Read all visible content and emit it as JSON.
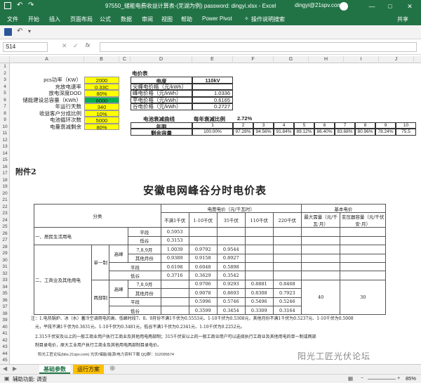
{
  "window": {
    "title": "97550_储能电费收益计算表-(芜湖为例) password: dingyi.xlsx  -  Excel",
    "user": "dingyi@21spv.com",
    "controls": [
      "—",
      "□",
      "✕"
    ]
  },
  "ribbon": {
    "tabs": [
      "文件",
      "开始",
      "插入",
      "页面布局",
      "公式",
      "数据",
      "审阅",
      "视图",
      "帮助",
      "Power Pivot"
    ],
    "search": "操作说明搜索",
    "share": "共享"
  },
  "formula_bar": {
    "name_box": "S14",
    "formula": "",
    "fx": "fx"
  },
  "columns": [
    "A",
    "B",
    "C",
    "D",
    "E",
    "F",
    "G",
    "H",
    "I",
    "J"
  ],
  "rows": [
    "1",
    "2",
    "3",
    "4",
    "5",
    "6",
    "7",
    "8",
    "9",
    "10",
    "11",
    "12",
    "13",
    "14",
    "15",
    "16",
    "17",
    "18",
    "19",
    "20",
    "21",
    "22",
    "23",
    "24",
    "25",
    "26",
    "27",
    "28",
    "29",
    "30",
    "31",
    "32",
    "33",
    "34",
    "35",
    "36",
    "37",
    "38",
    "39",
    "40",
    "41",
    "42",
    "43",
    "44",
    "45"
  ],
  "params": [
    {
      "label": "pcs功率（KW）",
      "value": "2000"
    },
    {
      "label": "充放电速率",
      "value": "0.33C"
    },
    {
      "label": "放电深度DOD",
      "value": "80%"
    },
    {
      "label": "储能建设总容量（KWh）",
      "value": "6000"
    },
    {
      "label": "年运行天数",
      "value": "340"
    },
    {
      "label": "收益客户分成比例",
      "value": "10%"
    },
    {
      "label": "电池循环次数",
      "value": "5000"
    },
    {
      "label": "电量衰减剩余",
      "value": "80%"
    }
  ],
  "price_table": {
    "header": "电价表",
    "col1": "电度",
    "col2": "110kV",
    "rows": [
      {
        "label": "尖峰电价格（元/kWh）",
        "value": ""
      },
      {
        "label": "峰电价格（元/kWh）",
        "value": "1.0336"
      },
      {
        "label": "平电价格（元/kWh）",
        "value": "0.6165"
      },
      {
        "label": "谷电价格（元/kWh）",
        "value": "0.2727"
      }
    ]
  },
  "decay": {
    "title": "电池衰减曲线",
    "rate_label": "每年衰减比例",
    "rate": "2.72%",
    "year_label": "年限",
    "years": [
      "1",
      "2",
      "3",
      "4",
      "5",
      "6",
      "7",
      "8",
      "9",
      "10"
    ],
    "cap_label": "剩余容量",
    "capacities": [
      "100.00%",
      "97.28%",
      "94.56%",
      "91.84%",
      "89.12%",
      "86.40%",
      "83.68%",
      "80.96%",
      "78.24%",
      "75.5"
    ]
  },
  "picture": {
    "attachment": "附件2",
    "title": "安徽电网峰谷分时电价表",
    "hdr_category": "分类",
    "hdr_energy": "电度电价（元/千瓦时）",
    "hdr_basic": "基本电价",
    "voltage_cols": [
      "不满1千伏",
      "1-10千伏",
      "35千伏",
      "110千伏",
      "220千伏"
    ],
    "basic_cols": [
      "最大需量（元/千瓦·月）",
      "变压器容量（元/千伏安·月）"
    ],
    "residential": "一、居民生活用电",
    "res_rows": [
      {
        "period": "平段",
        "v": "0.5953"
      },
      {
        "period": "低谷",
        "v": "0.3153"
      }
    ],
    "commercial": "二、工商业及其他用电",
    "single": "单一制",
    "dual": "两部制",
    "peak": "高峰",
    "single_rows": [
      {
        "period": "7,8,9月",
        "vals": [
          "1.0039",
          "0.9792",
          "0.9544",
          "",
          ""
        ]
      },
      {
        "period": "其他月份",
        "vals": [
          "0.9389",
          "0.9158",
          "0.8927",
          "",
          ""
        ]
      },
      {
        "period": "平段",
        "vals": [
          "0.6198",
          "0.6048",
          "0.5898",
          "",
          ""
        ]
      },
      {
        "period": "低谷",
        "vals": [
          "0.3716",
          "0.3629",
          "0.3542",
          "",
          ""
        ]
      }
    ],
    "dual_rows": [
      {
        "period": "7,8,9月",
        "vals": [
          "",
          "0.9706",
          "0.9293",
          "0.8881",
          "0.8468"
        ]
      },
      {
        "period": "其他月份",
        "vals": [
          "",
          "0.9078",
          "0.8693",
          "0.8308",
          "0.7923"
        ]
      },
      {
        "period": "平段",
        "vals": [
          "",
          "0.5996",
          "0.5746",
          "0.5496",
          "0.5246"
        ]
      },
      {
        "period": "低谷",
        "vals": [
          "",
          "0.3599",
          "0.3454",
          "0.3309",
          "0.3164"
        ]
      }
    ],
    "basic_values": [
      "40",
      "30"
    ],
    "notes": [
      "注：1.电热锅炉、冰（水）蓄冷空调用电的高、低峰时段7、8、9月份不满1千伏为0.5553元、1-10千伏为0.5308元，其他月份不满1千伏为0.5237元、1-10千伏为0.5008",
      "元，平段不满1千伏为0.3631元、1-10千伏为0.3481元，低谷不满1千伏为0.2341元、1-10千伏为0.2252元。",
      "2.315千伏安及以上的一般工商业用户执行工商业及其他用电两部制；315千伏安以上的一般工商业用户可以选择执行工商业及其他用电的单一制或两部",
      "制目录电价，原大工业用户执行工商业及其他用电两部制目录电价。"
    ],
    "footer": "阳光工匠论坛(bbs.21spv.com)    光伏/储能/能源/电力资料下载    QQ群：312095674"
  },
  "watermark": "阳光工匠光伏论坛",
  "sheets": [
    "基础参数",
    "运行方案"
  ],
  "status": {
    "accessibility": "辅助功能: 调查",
    "zoom": "85%"
  }
}
